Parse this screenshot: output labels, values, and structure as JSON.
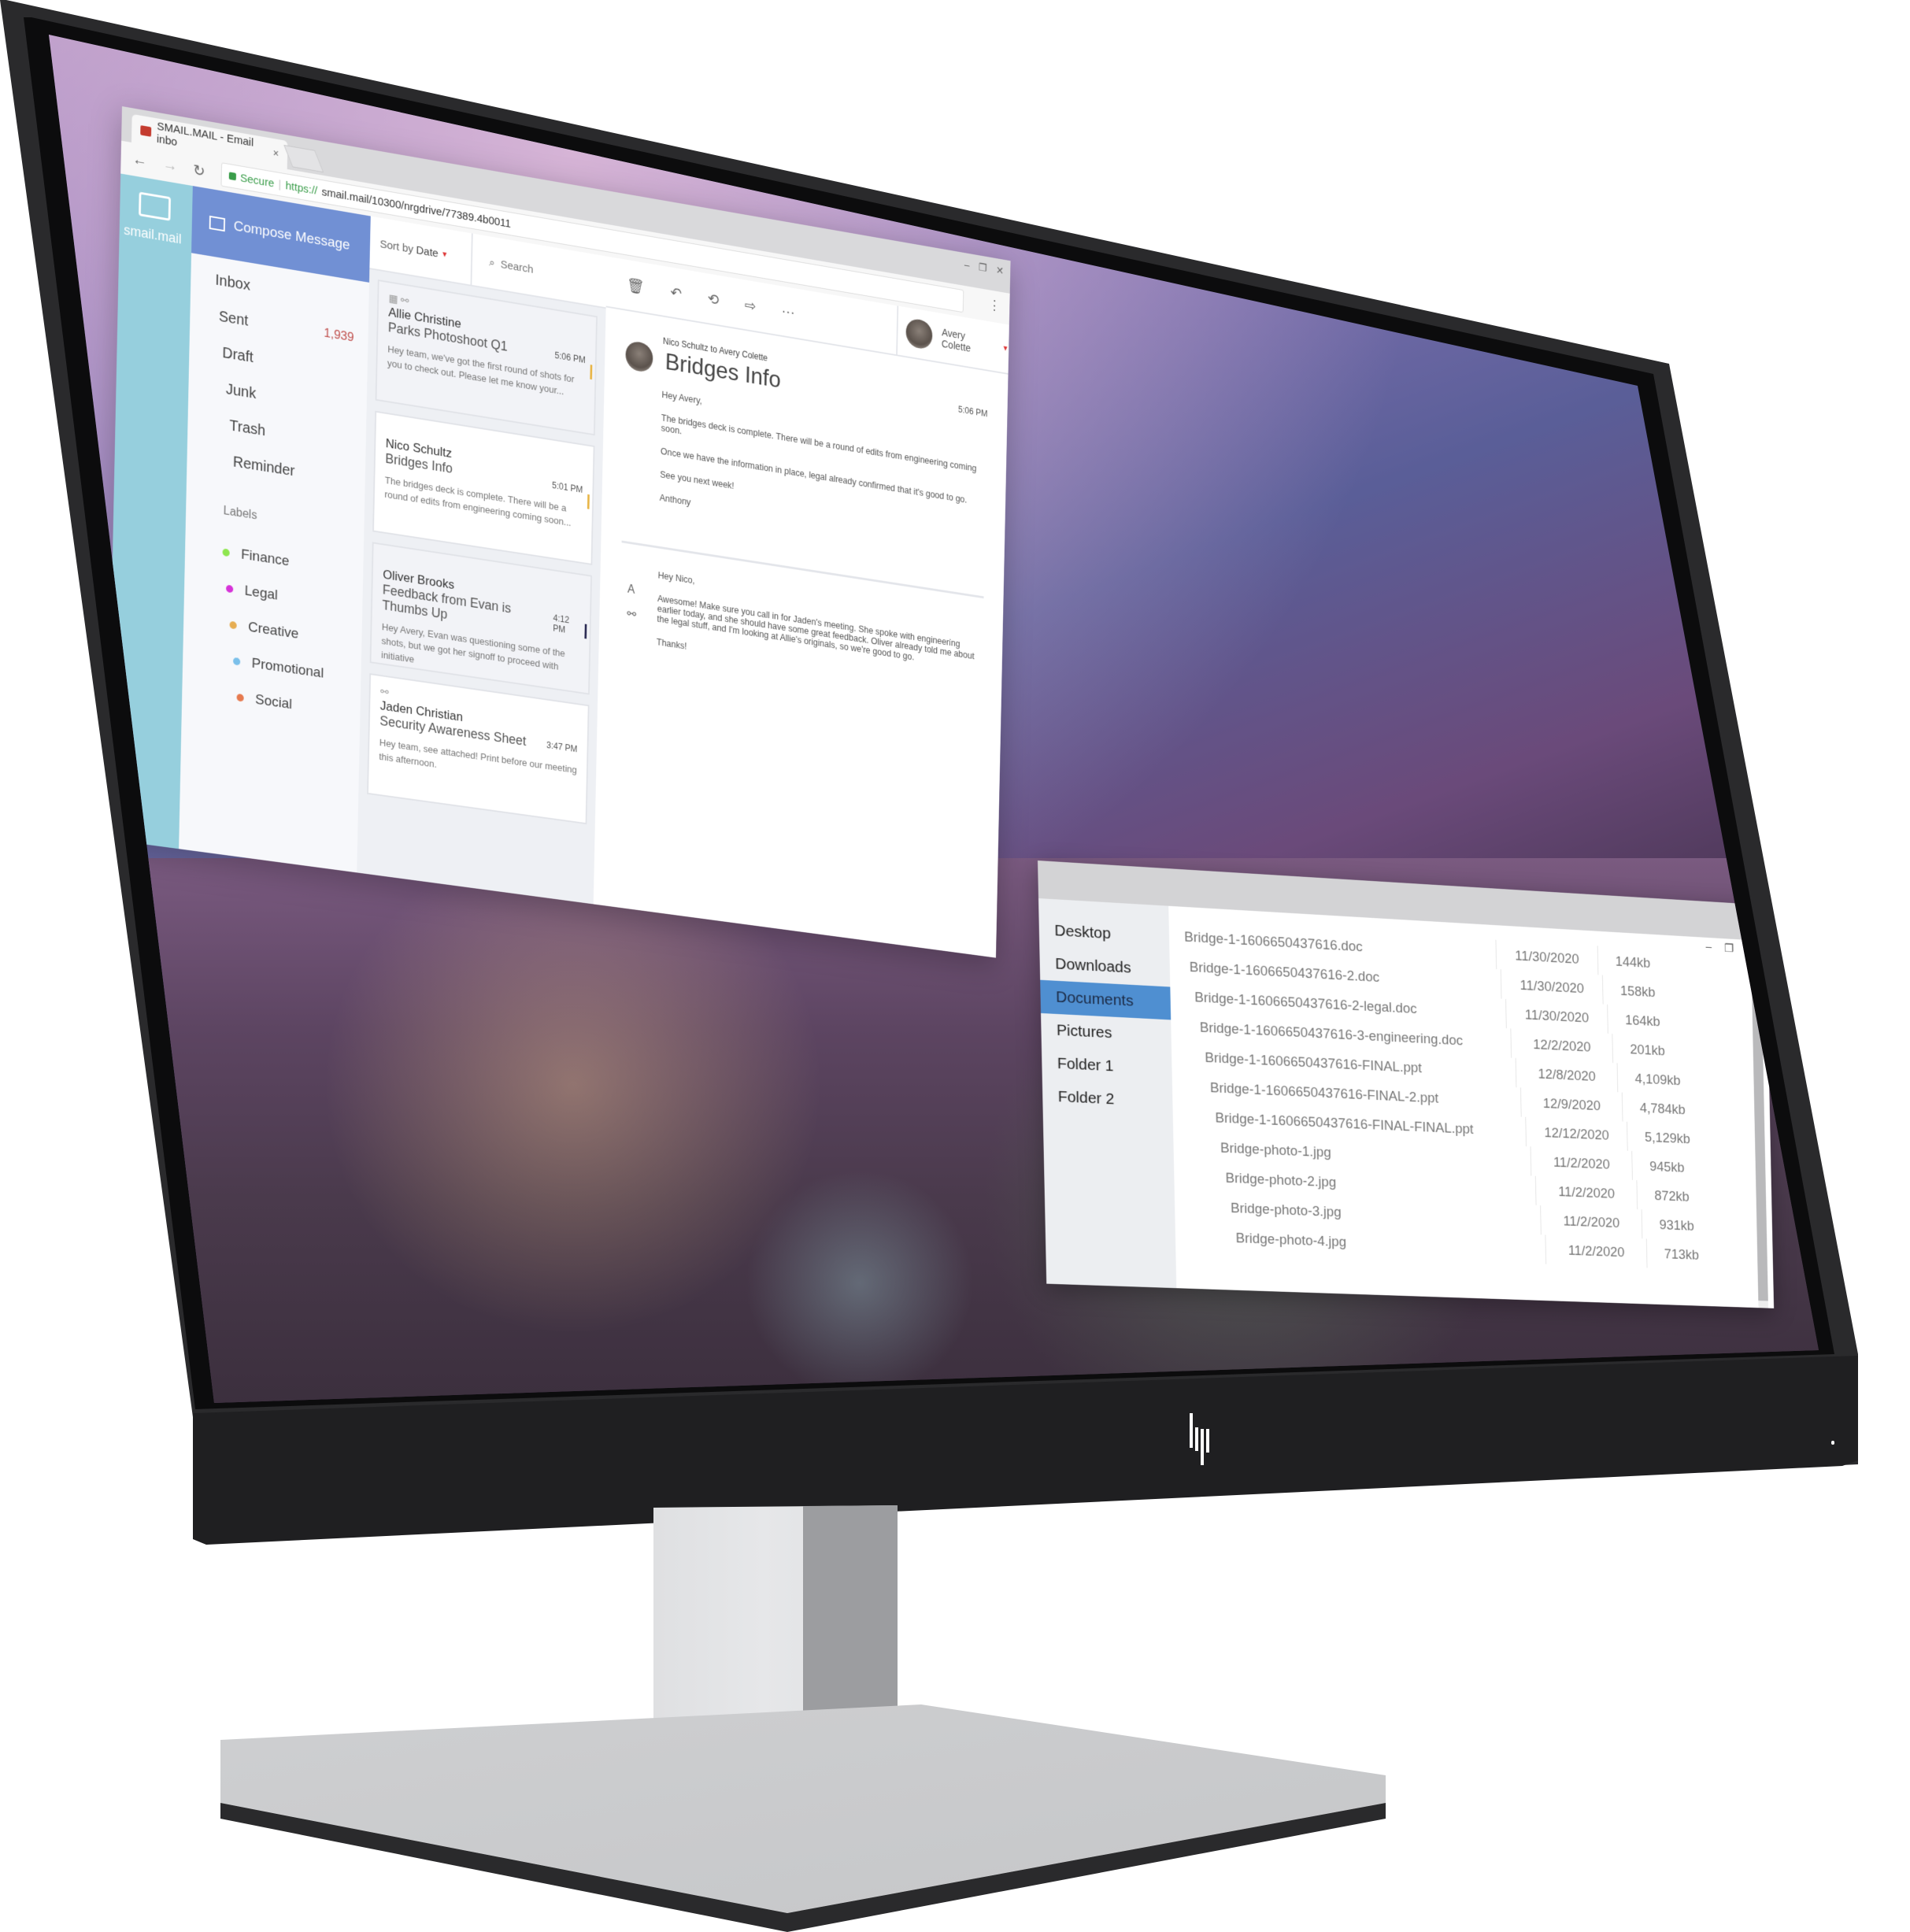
{
  "browser": {
    "tab_title": "SMAIL.MAIL - Email inbo",
    "tab_close": "×",
    "nav": {
      "back": "←",
      "forward": "→",
      "reload": "↻"
    },
    "secure_label": "Secure",
    "separator": "|",
    "url_scheme": "https://",
    "url_rest": "smail.mail/10300/nrgdrive/77389.4b0011",
    "window_controls": {
      "minimize": "–",
      "restore": "❐",
      "close": "✕"
    },
    "menu": "⋮"
  },
  "mail": {
    "brand": "smail.mail",
    "compose_label": "Compose Message",
    "folders": [
      {
        "label": "Inbox",
        "count": ""
      },
      {
        "label": "Sent",
        "count": "1,939"
      },
      {
        "label": "Draft",
        "count": ""
      },
      {
        "label": "Junk",
        "count": ""
      },
      {
        "label": "Trash",
        "count": ""
      },
      {
        "label": "Reminder",
        "count": ""
      }
    ],
    "labels_heading": "Labels",
    "labels": [
      {
        "label": "Finance",
        "color": "#8ee64f"
      },
      {
        "label": "Legal",
        "color": "#d633d8"
      },
      {
        "label": "Creative",
        "color": "#e6ad52"
      },
      {
        "label": "Promotional",
        "color": "#7bc0ea"
      },
      {
        "label": "Social",
        "color": "#e67a4f"
      }
    ],
    "sort": {
      "prefix": "Sort by",
      "value": "Date",
      "caret": "▼"
    },
    "search_placeholder": "Search",
    "messages": [
      {
        "icons": "▦ ⚯",
        "from": "Allie Christine",
        "subject": "Parks Photoshoot Q1",
        "time": "5:06 PM",
        "preview": "Hey team, we've got the first round of shots for you to check out. Please let me know your...",
        "flag_color": "#e8b546"
      },
      {
        "icons": "",
        "from": "Nico Schultz",
        "subject": "Bridges Info",
        "time": "5:01 PM",
        "preview": "The bridges deck is complete. There will be a round of edits from engineering coming soon...",
        "flag_color": "#e8b546"
      },
      {
        "icons": "",
        "from": "Oliver Brooks",
        "subject": "Feedback from Evan is Thumbs Up",
        "time": "4:12 PM",
        "preview": "Hey Avery, Evan was questioning some of the shots, but we got her signoff to proceed with initiative",
        "flag_color": "#2c2c54"
      },
      {
        "icons": "⚯",
        "from": "Jaden Christian",
        "subject": "Security Awareness Sheet",
        "time": "3:47 PM",
        "preview": "Hey team, see attached! Print before our meeting this afternoon.",
        "flag_color": ""
      }
    ],
    "actions": {
      "delete": "🗑",
      "reply": "↶",
      "reply_all": "⟲",
      "forward": "⇨",
      "more": "···"
    },
    "account": {
      "name": "Avery Colette",
      "caret": "▼"
    },
    "thread": {
      "meta": "Nico Schultz to Avery Colette",
      "title": "Bridges Info",
      "time": "5:06 PM",
      "body": [
        "Hey Avery,",
        "The bridges deck is complete. There will be a round of edits from engineering coming soon.",
        "Once we have the information in place, legal already confirmed that it's good to go.",
        "See you next week!",
        "Anthony"
      ],
      "reply_body": [
        "Hey Nico,",
        "Awesome! Make sure you call in for Jaden's meeting. She spoke with engineering earlier today, and she should have some great feedback. Oliver already told me about the legal stuff, and I'm looking at Allie's originals, so we're good to go.",
        "Thanks!"
      ],
      "tools": {
        "format": "A",
        "attach": "⚯"
      }
    }
  },
  "files": {
    "window_controls": {
      "minimize": "–",
      "restore": "❐",
      "close": "✕"
    },
    "nav": [
      {
        "label": "Desktop",
        "active": false
      },
      {
        "label": "Downloads",
        "active": false
      },
      {
        "label": "Documents",
        "active": true
      },
      {
        "label": "Pictures",
        "active": false
      },
      {
        "label": "Folder 1",
        "active": false
      },
      {
        "label": "Folder 2",
        "active": false
      }
    ],
    "rows": [
      {
        "name": "Bridge-1-1606650437616.doc",
        "date": "11/30/2020",
        "size": "144kb"
      },
      {
        "name": "Bridge-1-1606650437616-2.doc",
        "date": "11/30/2020",
        "size": "158kb"
      },
      {
        "name": "Bridge-1-1606650437616-2-legal.doc",
        "date": "11/30/2020",
        "size": "164kb"
      },
      {
        "name": "Bridge-1-1606650437616-3-engineering.doc",
        "date": "12/2/2020",
        "size": "201kb"
      },
      {
        "name": "Bridge-1-1606650437616-FINAL.ppt",
        "date": "12/8/2020",
        "size": "4,109kb"
      },
      {
        "name": "Bridge-1-1606650437616-FINAL-2.ppt",
        "date": "12/9/2020",
        "size": "4,784kb"
      },
      {
        "name": "Bridge-1-1606650437616-FINAL-FINAL.ppt",
        "date": "12/12/2020",
        "size": "5,129kb"
      },
      {
        "name": "Bridge-photo-1.jpg",
        "date": "11/2/2020",
        "size": "945kb"
      },
      {
        "name": "Bridge-photo-2.jpg",
        "date": "11/2/2020",
        "size": "872kb"
      },
      {
        "name": "Bridge-photo-3.jpg",
        "date": "11/2/2020",
        "size": "931kb"
      },
      {
        "name": "Bridge-photo-4.jpg",
        "date": "11/2/2020",
        "size": "713kb"
      }
    ]
  },
  "colors": {
    "brand_sidebar": "#96cfdd",
    "compose_accent": "#7190d4",
    "selected_folder": "#4f8fd1",
    "count_red": "#c0504d"
  }
}
